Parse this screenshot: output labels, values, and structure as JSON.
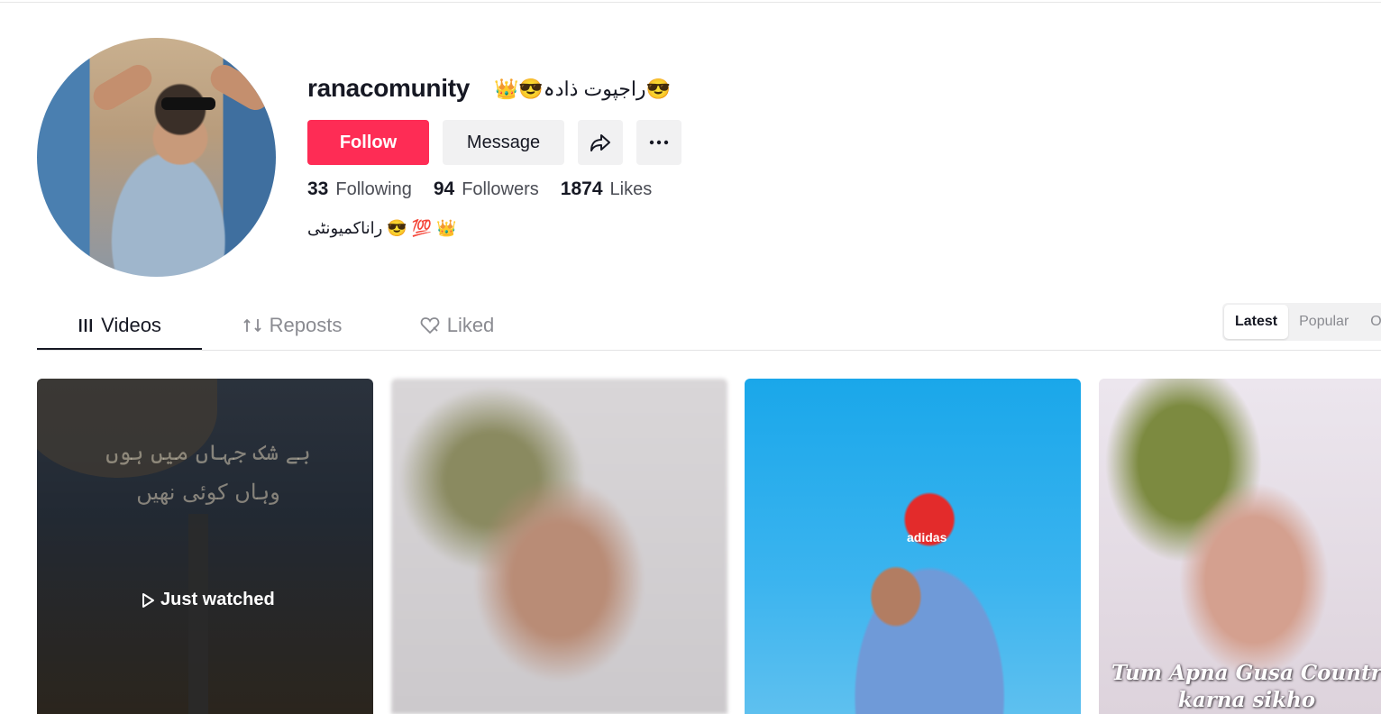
{
  "profile": {
    "username": "ranacomunity",
    "nickname": "👑😎راجپوت ذادہ😎",
    "follow_label": "Follow",
    "message_label": "Message",
    "bio": "راناکمیونٹی 😎 💯 👑"
  },
  "stats": [
    {
      "value": "33",
      "label": "Following"
    },
    {
      "value": "94",
      "label": "Followers"
    },
    {
      "value": "1874",
      "label": "Likes"
    }
  ],
  "tabs": [
    {
      "label": "Videos",
      "icon": "grid-bars-icon"
    },
    {
      "label": "Reposts",
      "icon": "repost-icon"
    },
    {
      "label": "Liked",
      "icon": "heart-icon"
    }
  ],
  "sort": [
    "Latest",
    "Popular",
    "Oldest"
  ],
  "videos": [
    {
      "overlay": "Just watched",
      "caption_lines": [
        "بے شک جہاں میں ہوں",
        "وہاں کوئی نھیں"
      ]
    },
    {},
    {
      "logo": "adidas"
    },
    {
      "caption_lines": [
        "Tum Apna Gusa Countrol",
        "karna sikho"
      ]
    }
  ],
  "colors": {
    "accent": "#fe2c55",
    "button_bg": "#f1f1f2",
    "text": "#161823",
    "muted": "#8a8b91"
  }
}
